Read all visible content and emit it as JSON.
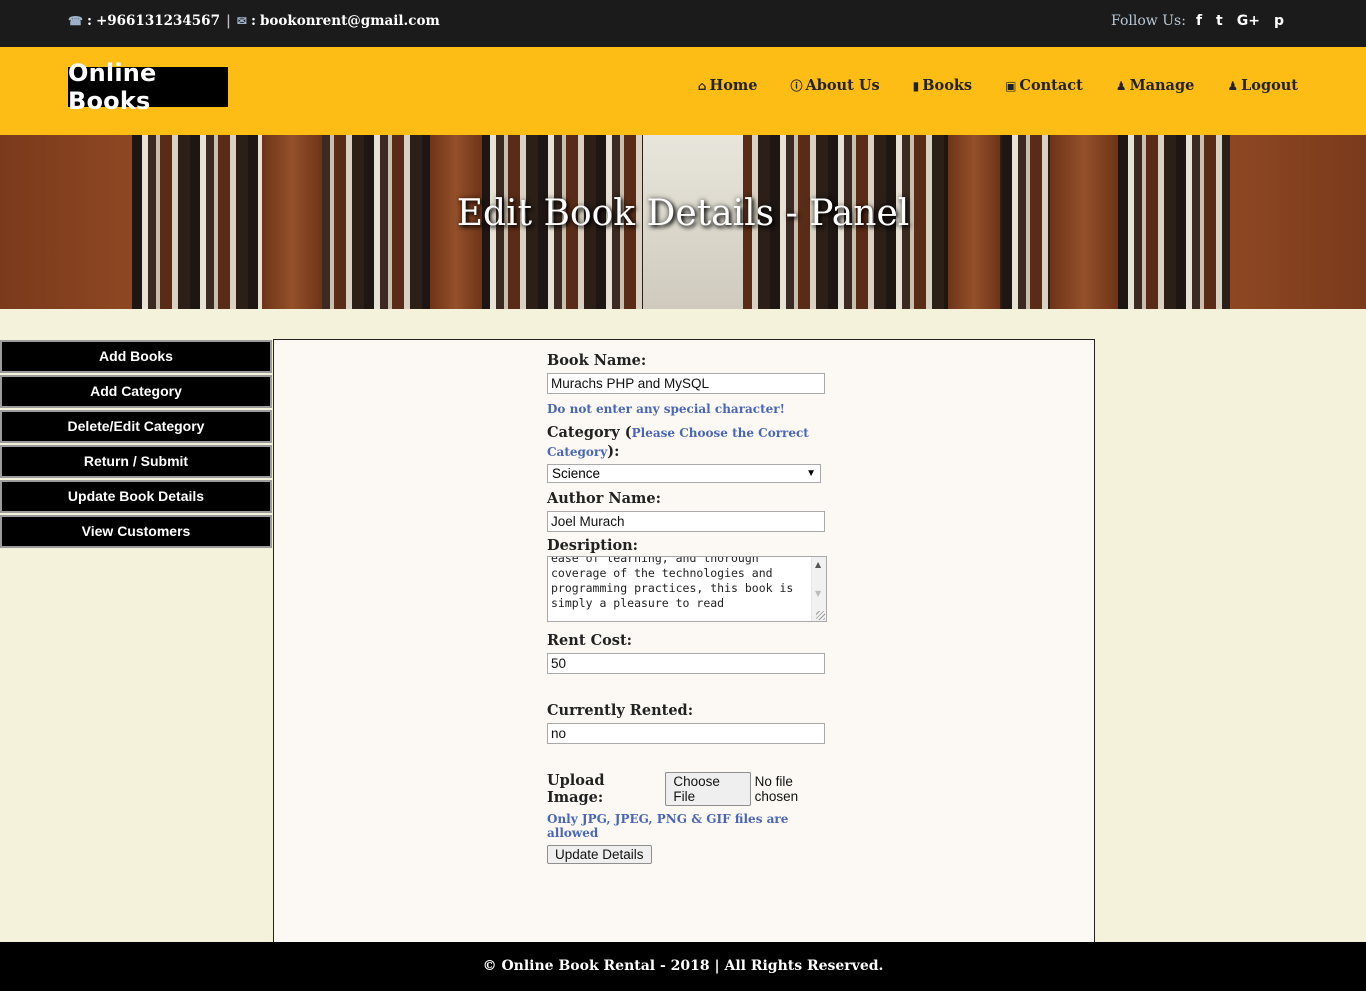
{
  "topbar": {
    "phone": "+966131234567",
    "phone_prefix": ":",
    "email": "bookonrent@gmail.com",
    "email_prefix": ":",
    "divider": "|",
    "follow_label": "Follow Us:",
    "social": [
      "f",
      "t",
      "G+",
      "p"
    ]
  },
  "header": {
    "logo": "Online Books",
    "nav": {
      "home": "Home",
      "about": "About Us",
      "books": "Books",
      "contact": "Contact",
      "manage": "Manage",
      "logout": "Logout"
    }
  },
  "banner": {
    "title": "Edit Book Details - Panel"
  },
  "sidebar": {
    "items": [
      "Add Books",
      "Add Category",
      "Delete/Edit Category",
      "Return / Submit",
      "Update Book Details",
      "View Customers"
    ]
  },
  "form": {
    "book_name_label": "Book Name:",
    "book_name_value": "Murachs PHP and MySQL",
    "book_name_hint": "Do not enter any special character!",
    "category_label": "Category (",
    "category_hint": "Please Choose the Correct Category",
    "category_label_end": "):",
    "category_value": "Science",
    "author_label": "Author Name:",
    "author_value": "Joel Murach",
    "description_label": "Desription:",
    "description_value": "ease of learning, and thorough coverage of the technologies and programming practices, this book is simply a pleasure to read",
    "rent_label": "Rent Cost:",
    "rent_value": "50",
    "rented_label": "Currently Rented:",
    "rented_value": "no",
    "upload_label": "Upload Image:",
    "choose_file": "Choose File",
    "no_file": "No file chosen",
    "upload_hint": "Only JPG, JPEG, PNG & GIF files are allowed",
    "submit": "Update Details"
  },
  "footer": {
    "text": "© Online Book Rental - 2018 | All Rights Reserved."
  },
  "colors": {
    "header_bg": "#fdbd14",
    "topbar_bg": "#1c1b1b",
    "page_bg": "#f5f2dc",
    "hint": "#4a67b7"
  }
}
